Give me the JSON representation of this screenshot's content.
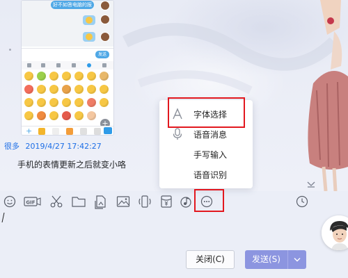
{
  "colors": {
    "accent": "#1c6ee6",
    "send_button": "#8c95e0",
    "highlight": "#e2171e"
  },
  "conversation": {
    "screenshot_image": {
      "top_bubble_text": "好不如答电脑的报",
      "send_label": "发送"
    },
    "message": {
      "sender": "很多",
      "timestamp": "2019/4/27 17:42:27",
      "text": "手机的表情更新之后就变小咯"
    }
  },
  "popup_menu": {
    "items": [
      {
        "label": "字体选择",
        "icon": "font-icon"
      },
      {
        "label": "语音消息",
        "icon": "microphone-icon"
      },
      {
        "label": "手写输入",
        "icon": ""
      },
      {
        "label": "语音识别",
        "icon": ""
      }
    ]
  },
  "toolbar": {
    "icons": [
      "emoji-icon",
      "gif-icon",
      "scissors-icon",
      "folder-icon",
      "picture-file-icon",
      "image-icon",
      "phone-shake-icon",
      "red-packet-icon",
      "music-icon",
      "more-icon",
      "history-clock-icon"
    ],
    "gif_label": "GIF"
  },
  "composer": {
    "value": "",
    "close_label": "关闭(C)",
    "send_label": "发送(S)"
  }
}
